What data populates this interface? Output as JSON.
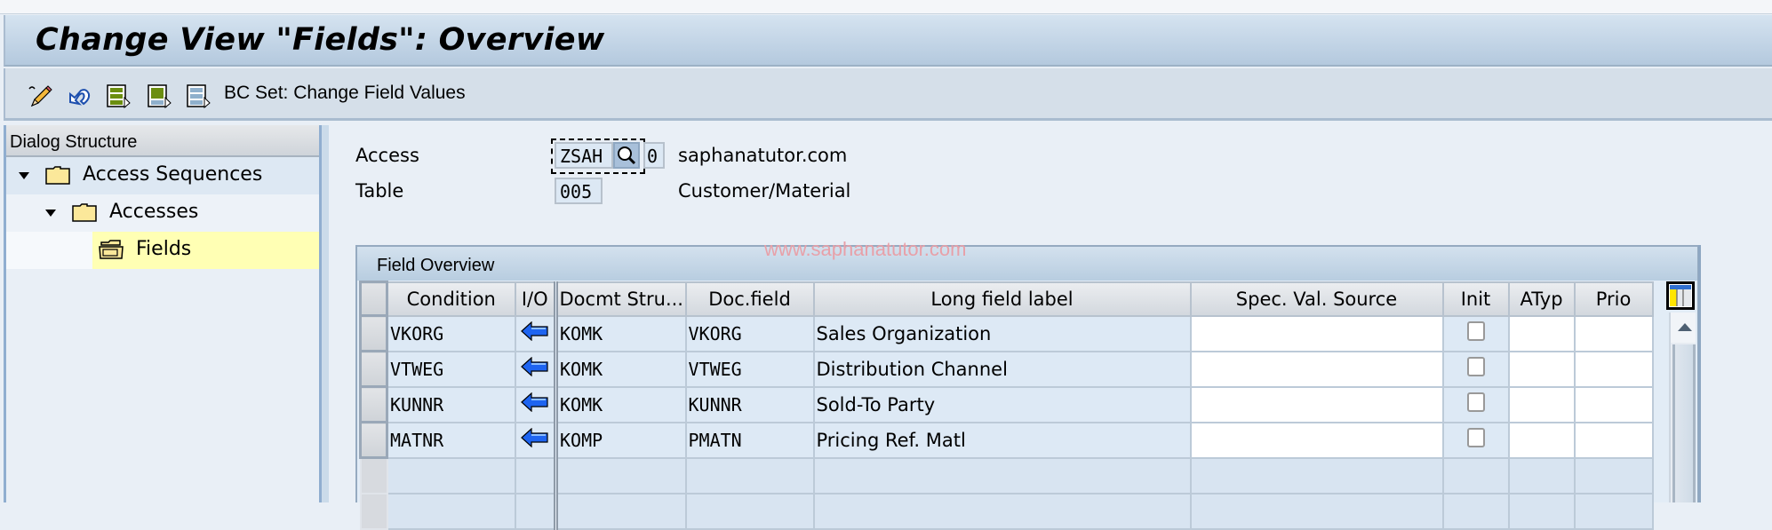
{
  "window": {
    "title": "Change View \"Fields\": Overview"
  },
  "toolbar": {
    "icons": [
      "edit-pencil-icon",
      "undo-icon",
      "select-all-icon",
      "select-block-icon",
      "deselect-all-icon"
    ],
    "bc_set_label": "BC Set: Change Field Values"
  },
  "sidebar": {
    "header": "Dialog Structure",
    "items": [
      {
        "label": "Access Sequences",
        "level": 0,
        "expanded": true,
        "icon": "folder-closed-icon"
      },
      {
        "label": "Accesses",
        "level": 1,
        "expanded": true,
        "icon": "folder-closed-icon"
      },
      {
        "label": "Fields",
        "level": 2,
        "selected": true,
        "icon": "folder-open-icon"
      }
    ]
  },
  "header_fields": {
    "access": {
      "label": "Access",
      "value": "ZSAH",
      "number": "0",
      "description": "saphanatutor.com"
    },
    "table": {
      "label": "Table",
      "value": "005",
      "description": "Customer/Material"
    }
  },
  "watermark": "www.saphanatutor.com",
  "field_overview": {
    "title": "Field Overview",
    "columns": [
      "Condition",
      "I/O",
      "Docmt Stru...",
      "Doc.field",
      "Long field label",
      "Spec. Val. Source",
      "Init",
      "ATyp",
      "Prio"
    ],
    "rows": [
      {
        "condition": "VKORG",
        "io": "left-arrow",
        "docmt_struct": "KOMK",
        "doc_field": "VKORG",
        "long_label": "Sales Organization",
        "spec_val_source": "",
        "init": false,
        "atyp": "",
        "prio": ""
      },
      {
        "condition": "VTWEG",
        "io": "left-arrow",
        "docmt_struct": "KOMK",
        "doc_field": "VTWEG",
        "long_label": "Distribution Channel",
        "spec_val_source": "",
        "init": false,
        "atyp": "",
        "prio": ""
      },
      {
        "condition": "KUNNR",
        "io": "left-arrow",
        "docmt_struct": "KOMK",
        "doc_field": "KUNNR",
        "long_label": "Sold-To Party",
        "spec_val_source": "",
        "init": false,
        "atyp": "",
        "prio": ""
      },
      {
        "condition": "MATNR",
        "io": "left-arrow",
        "docmt_struct": "KOMP",
        "doc_field": "PMATN",
        "long_label": "Pricing Ref. Matl",
        "spec_val_source": "",
        "init": false,
        "atyp": "",
        "prio": ""
      }
    ],
    "empty_rows": 2
  },
  "colors": {
    "selected_node": "#ffffb4",
    "io_arrow": "#1e64f0",
    "title_gradient_top": "#d5e3f0"
  }
}
